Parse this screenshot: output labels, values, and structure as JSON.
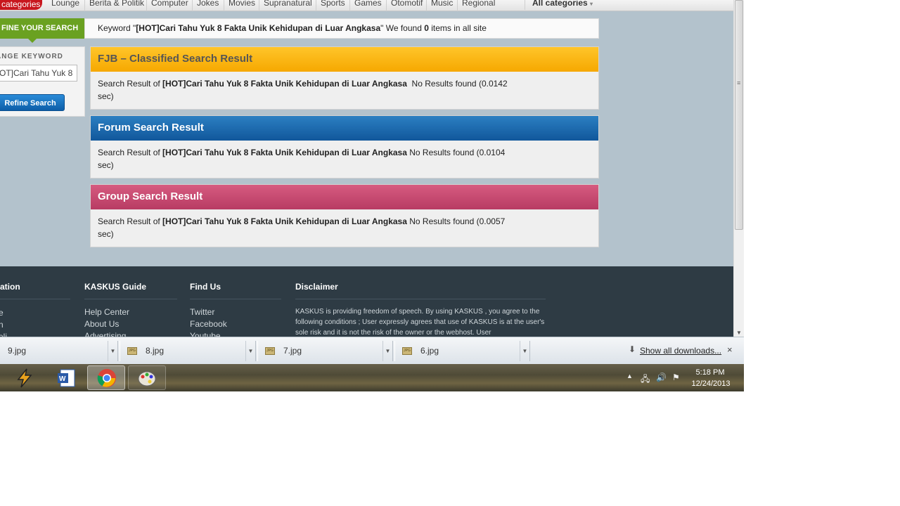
{
  "nav": {
    "categories_tab": "categories",
    "items": [
      "Lounge",
      "Berita & Politik",
      "Computer",
      "Jokes",
      "Movies",
      "Supranatural",
      "Sports",
      "Games",
      "Otomotif",
      "Music",
      "Regional"
    ],
    "all_categories": "All categories"
  },
  "refine": {
    "header": "FINE YOUR SEARCH",
    "change_label": "ANGE KEYWORD",
    "input_value": "OT]Cari Tahu Yuk 8",
    "button": "Refine Search"
  },
  "keyword_bar": {
    "prefix": "Keyword \"",
    "keyword": "[HOT]Cari Tahu Yuk 8 Fakta Unik Kehidupan di Luar Angkasa",
    "middle": "\" We found ",
    "count": "0",
    "suffix": " items in all site"
  },
  "results": {
    "fjb": {
      "title": "FJB – Classified Search Result",
      "prefix": "Search Result of ",
      "keyword": "[HOT]Cari Tahu Yuk 8 Fakta Unik Kehidupan di Luar Angkasa",
      "status": "  No Results found (0.0142 sec)"
    },
    "forum": {
      "title": "Forum Search Result",
      "prefix": "Search Result of ",
      "keyword": "[HOT]Cari Tahu Yuk 8 Fakta Unik Kehidupan di Luar Angkasa",
      "status": " No Results found (0.0104 sec)"
    },
    "group": {
      "title": "Group Search Result",
      "prefix": "Search Result of ",
      "keyword": "[HOT]Cari Tahu Yuk 8 Fakta Unik Kehidupan di Luar Angkasa",
      "status": " No Results found (0.0057 sec)"
    }
  },
  "footer": {
    "col1_title": "ation",
    "col1_links": [
      "e",
      "n",
      "eli"
    ],
    "guide_title": "KASKUS Guide",
    "guide_links": [
      "Help Center",
      "About Us",
      "Advertising"
    ],
    "find_title": "Find Us",
    "find_links": [
      "Twitter",
      "Facebook",
      "Youtube"
    ],
    "disclaimer_title": "Disclaimer",
    "disclaimer_text": "KASKUS is providing freedom of speech. By using KASKUS , you agree to the following conditions ; User expressly agrees that use of KASKUS is at the user's sole risk and it is not the risk of the owner or the webhost. User"
  },
  "downloads": {
    "items": [
      "9.jpg",
      "8.jpg",
      "7.jpg",
      "6.jpg"
    ],
    "show_all": "Show all downloads...",
    "close": "×"
  },
  "taskbar": {
    "time": "5:18 PM",
    "date": "12/24/2013"
  }
}
